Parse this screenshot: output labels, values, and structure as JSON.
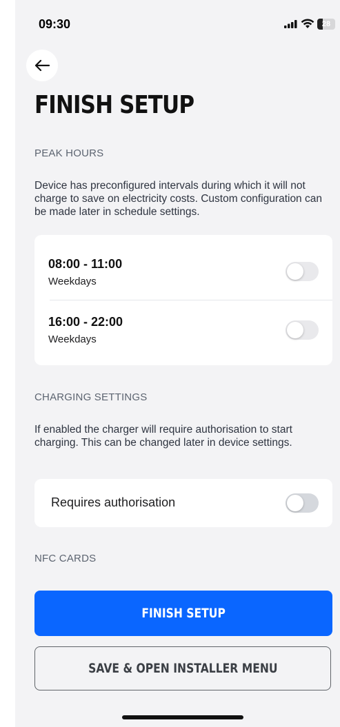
{
  "status_bar": {
    "time": "09:30",
    "battery_level": "28",
    "icons": [
      "signal-icon",
      "wifi-icon",
      "battery-icon"
    ]
  },
  "header": {
    "back_icon": "arrow-left-icon",
    "title": "FINISH SETUP"
  },
  "peak_hours": {
    "label": "PEAK HOURS",
    "description": "Device has preconfigured intervals during which it will not charge to save on electricity costs. Custom configuration can be made later in schedule settings.",
    "slots": [
      {
        "time": "08:00 - 11:00",
        "days": "Weekdays",
        "enabled": false
      },
      {
        "time": "16:00 - 22:00",
        "days": "Weekdays",
        "enabled": false
      }
    ]
  },
  "charging_settings": {
    "label": "CHARGING SETTINGS",
    "description": "If enabled the charger will require authorisation to start charging. This can be changed later in device settings.",
    "requires_auth_label": "Requires authorisation",
    "requires_auth_enabled": false
  },
  "nfc_cards": {
    "label": "NFC CARDS"
  },
  "actions": {
    "primary_label": "FINISH SETUP",
    "secondary_label": "SAVE & OPEN INSTALLER MENU"
  },
  "colors": {
    "accent": "#0a66ff",
    "background": "#f3f3f5",
    "card": "#ffffff"
  }
}
